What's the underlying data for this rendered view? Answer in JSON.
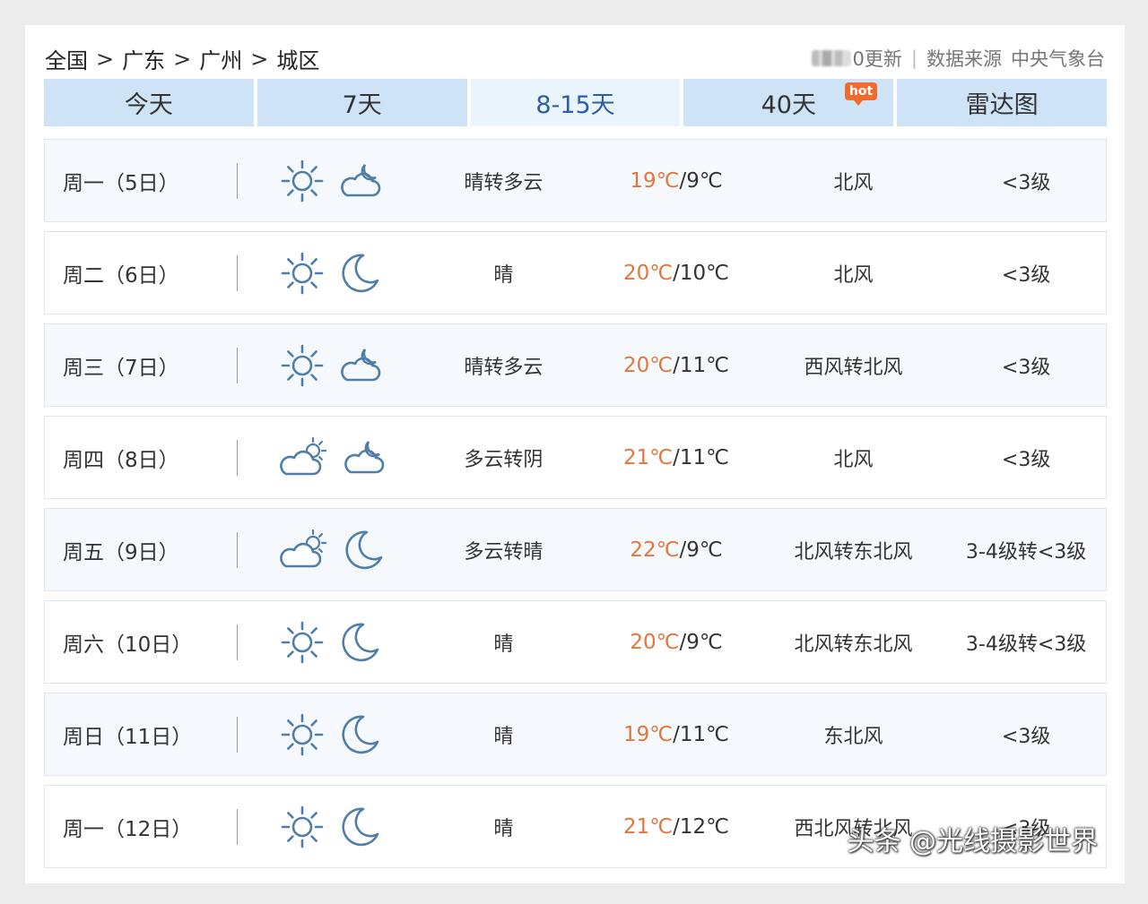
{
  "breadcrumb": [
    {
      "label": "全国"
    },
    {
      "label": "广东"
    },
    {
      "label": "广州"
    },
    {
      "label": "城区"
    }
  ],
  "breadcrumb_separator": ">",
  "header": {
    "update_text": "0更新",
    "source_label": "数据来源",
    "source_name": "中央气象台",
    "divider": "|"
  },
  "tabs": [
    {
      "label": "今天",
      "active": false
    },
    {
      "label": "7天",
      "active": false
    },
    {
      "label": "8-15天",
      "active": true
    },
    {
      "label": "40天",
      "active": false,
      "badge": "hot"
    },
    {
      "label": "雷达图",
      "active": false
    }
  ],
  "colors": {
    "tab_bg": "#cfe3f6",
    "tab_active_bg": "#eaf4fd",
    "tab_active_text": "#2c5ea8",
    "high_temp": "#e2763a",
    "icon_stroke": "#4f7ea8",
    "hot_badge": "#f26b2d"
  },
  "forecast": [
    {
      "day": "周一（5日）",
      "day_icon": "sun-icon",
      "night_icon": "cloud-moon-icon",
      "desc": "晴转多云",
      "high": "19℃",
      "low": "/9℃",
      "wind": "北风",
      "level": "<3级"
    },
    {
      "day": "周二（6日）",
      "day_icon": "sun-icon",
      "night_icon": "moon-icon",
      "desc": "晴",
      "high": "20℃",
      "low": "/10℃",
      "wind": "北风",
      "level": "<3级"
    },
    {
      "day": "周三（7日）",
      "day_icon": "sun-icon",
      "night_icon": "cloud-moon-icon",
      "desc": "晴转多云",
      "high": "20℃",
      "low": "/11℃",
      "wind": "西风转北风",
      "level": "<3级"
    },
    {
      "day": "周四（8日）",
      "day_icon": "cloud-sun-icon",
      "night_icon": "cloud-moon-icon",
      "desc": "多云转阴",
      "high": "21℃",
      "low": "/11℃",
      "wind": "北风",
      "level": "<3级"
    },
    {
      "day": "周五（9日）",
      "day_icon": "cloud-sun-icon",
      "night_icon": "moon-icon",
      "desc": "多云转晴",
      "high": "22℃",
      "low": "/9℃",
      "wind": "北风转东北风",
      "level": "3-4级转<3级"
    },
    {
      "day": "周六（10日）",
      "day_icon": "sun-icon",
      "night_icon": "moon-icon",
      "desc": "晴",
      "high": "20℃",
      "low": "/9℃",
      "wind": "北风转东北风",
      "level": "3-4级转<3级"
    },
    {
      "day": "周日（11日）",
      "day_icon": "sun-icon",
      "night_icon": "moon-icon",
      "desc": "晴",
      "high": "19℃",
      "low": "/11℃",
      "wind": "东北风",
      "level": "<3级"
    },
    {
      "day": "周一（12日）",
      "day_icon": "sun-icon",
      "night_icon": "moon-icon",
      "desc": "晴",
      "high": "21℃",
      "low": "/12℃",
      "wind": "西北风转北风",
      "level": "<3级"
    }
  ],
  "watermark": "头条 @光线摄影世界"
}
